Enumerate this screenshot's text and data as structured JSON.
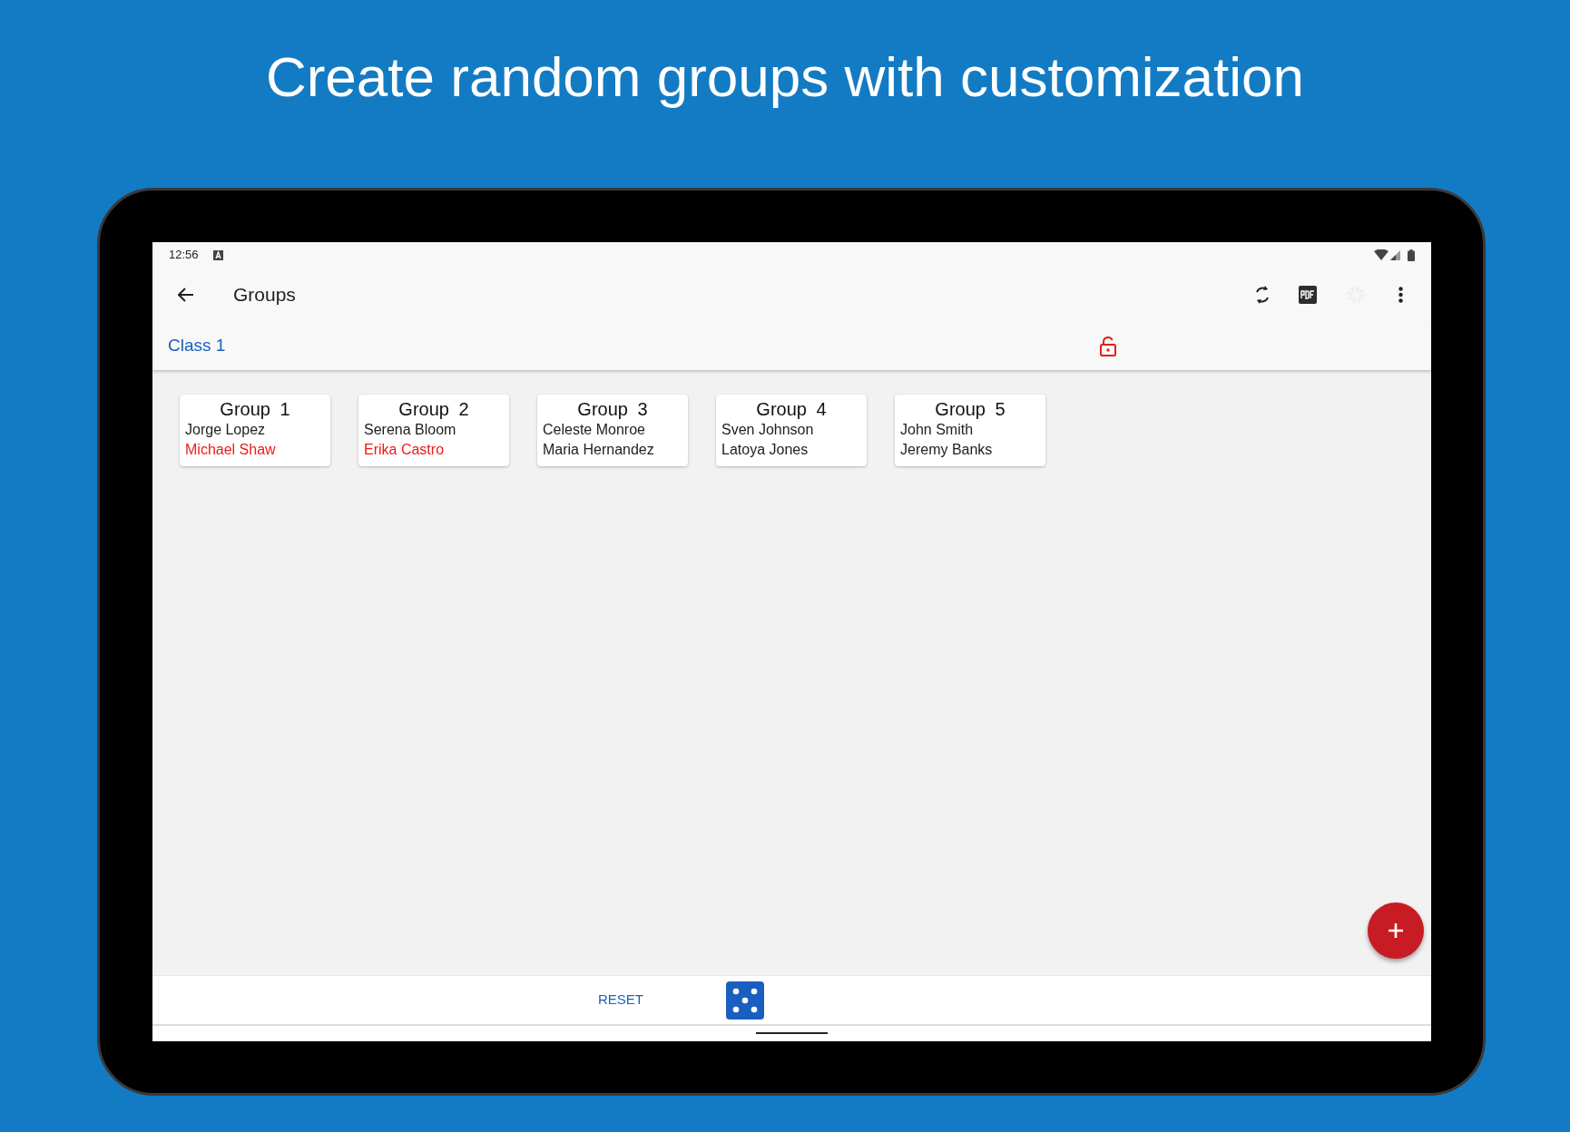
{
  "headline": "Create random groups with customization",
  "status_bar": {
    "time": "12:56"
  },
  "toolbar": {
    "title": "Groups"
  },
  "class_bar": {
    "name": "Class 1",
    "locked": false
  },
  "groups": [
    {
      "title": "Group 1",
      "members": [
        {
          "name": "Jorge Lopez",
          "color": "#212121"
        },
        {
          "name": "Michael Shaw",
          "color": "#f01818"
        }
      ]
    },
    {
      "title": "Group 2",
      "members": [
        {
          "name": "Serena Bloom",
          "color": "#212121"
        },
        {
          "name": "Erika Castro",
          "color": "#f01818"
        }
      ]
    },
    {
      "title": "Group 3",
      "members": [
        {
          "name": "Celeste Monroe",
          "color": "#212121"
        },
        {
          "name": "Maria Hernandez",
          "color": "#212121"
        }
      ]
    },
    {
      "title": "Group 4",
      "members": [
        {
          "name": "Sven Johnson",
          "color": "#212121"
        },
        {
          "name": "Latoya Jones",
          "color": "#212121"
        }
      ]
    },
    {
      "title": "Group 5",
      "members": [
        {
          "name": "John Smith",
          "color": "#212121"
        },
        {
          "name": "Jeremy Banks",
          "color": "#212121"
        }
      ]
    }
  ],
  "bottom_bar": {
    "reset_label": "RESET"
  }
}
